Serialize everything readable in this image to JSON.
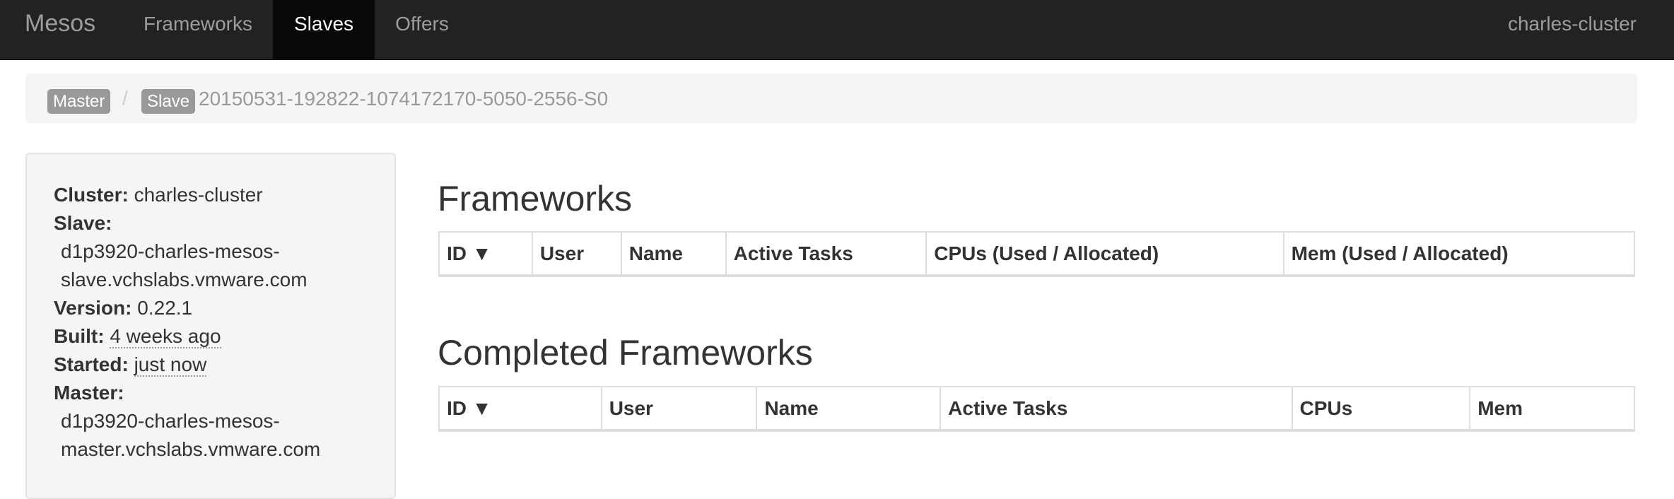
{
  "nav": {
    "brand": "Mesos",
    "items": [
      {
        "label": "Frameworks",
        "active": false
      },
      {
        "label": "Slaves",
        "active": true
      },
      {
        "label": "Offers",
        "active": false
      }
    ],
    "cluster": "charles-cluster"
  },
  "breadcrumb": {
    "master_label": "Master",
    "separator": "/",
    "slave_label": "Slave",
    "slave_id": "20150531-192822-1074172170-5050-2556-S0"
  },
  "info": {
    "cluster_key": "Cluster:",
    "cluster_value": "charles-cluster",
    "slave_key": "Slave:",
    "slave_line1": "d1p3920-charles-mesos-",
    "slave_line2": "slave.vchslabs.vmware.com",
    "version_key": "Version:",
    "version_value": "0.22.1",
    "built_key": "Built:",
    "built_value": "4 weeks ago",
    "started_key": "Started:",
    "started_value": "just now",
    "master_key": "Master:",
    "master_line1": "d1p3920-charles-mesos-",
    "master_line2": "master.vchslabs.vmware.com"
  },
  "frameworks": {
    "title": "Frameworks",
    "columns": [
      "ID ▼",
      "User",
      "Name",
      "Active Tasks",
      "CPUs (Used / Allocated)",
      "Mem (Used / Allocated)"
    ]
  },
  "completed": {
    "title": "Completed Frameworks",
    "columns": [
      "ID ▼",
      "User",
      "Name",
      "Active Tasks",
      "CPUs",
      "Mem"
    ]
  }
}
